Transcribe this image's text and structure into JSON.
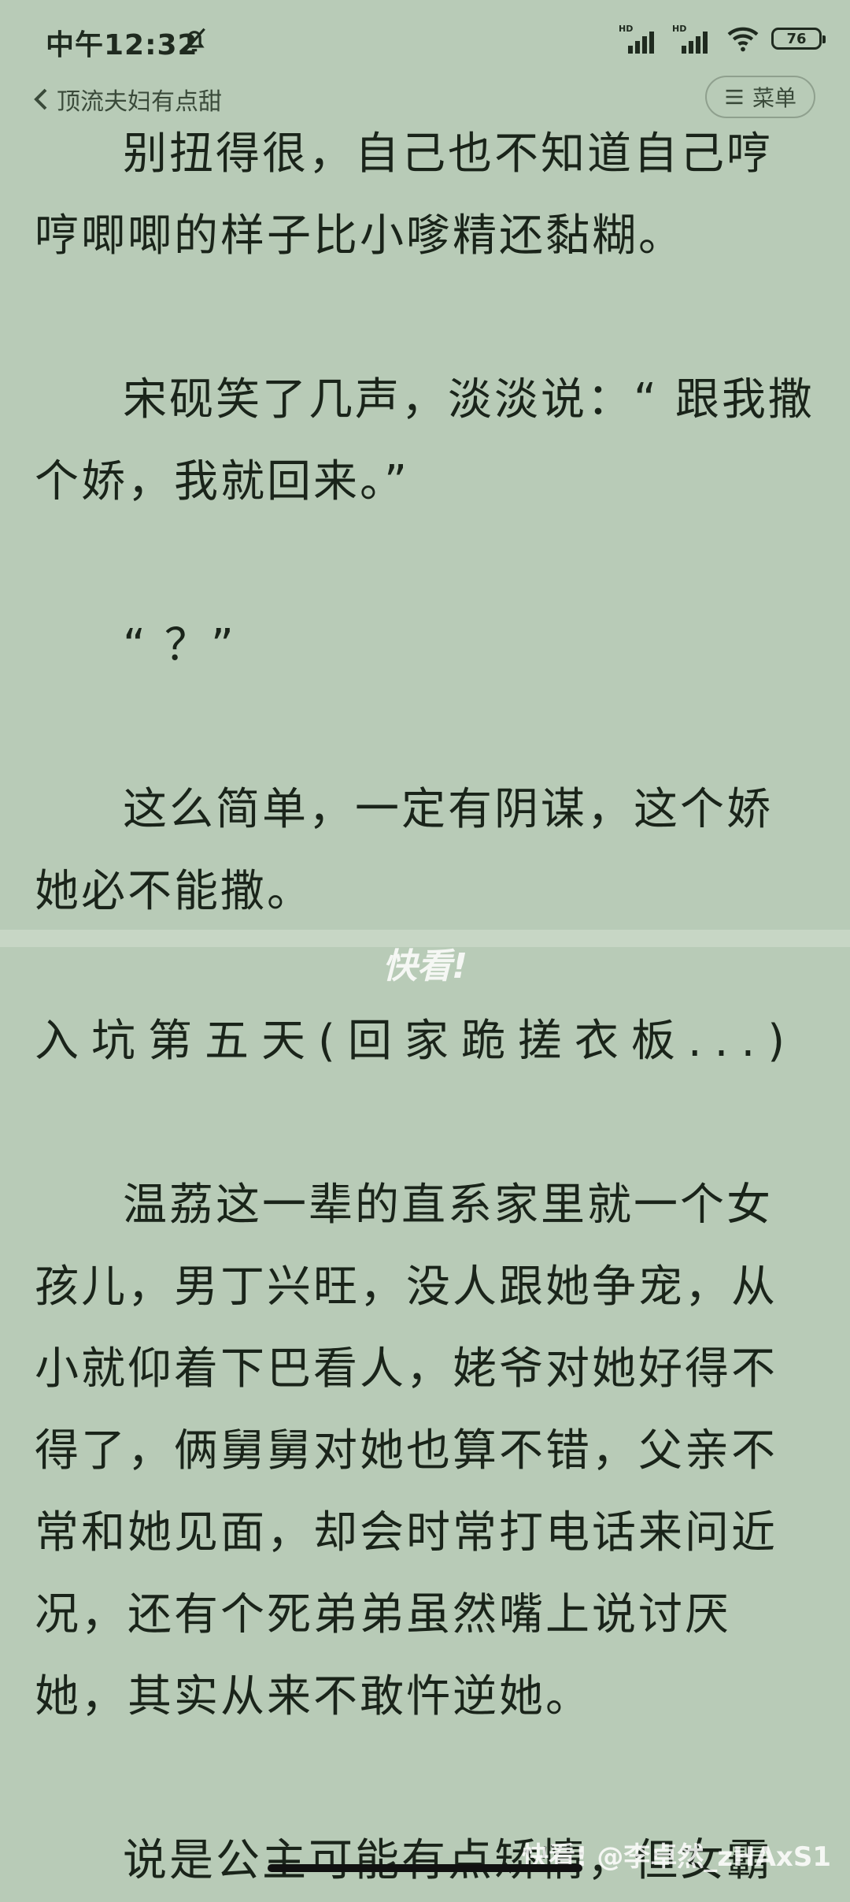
{
  "status_bar": {
    "time": "中午12:32",
    "network_labels": [
      "HD",
      "HD"
    ],
    "battery": "76"
  },
  "header": {
    "back_label": "顶流夫妇有点甜",
    "menu_label": "菜单",
    "menu_icon": "menu-lines-icon"
  },
  "content_top": {
    "paragraphs": [
      "别扭得很，自己也不知道自己哼哼唧唧的样子比小嗲精还黏糊。",
      "宋砚笑了几声，淡淡说：“ 跟我撒个娇，我就回来。”",
      "“ ？”",
      "这么简单，一定有阴谋，这个娇她必不能撒。"
    ]
  },
  "watermarks": {
    "center": "快看!",
    "bottom": "快看! @李卓然_zHAxS1"
  },
  "content_bottom": {
    "chapter_title": "入坑第五天(回家跪搓衣板...)",
    "paragraphs": [
      "温荔这一辈的直系家里就一个女孩儿，男丁兴旺，没人跟她争宠，从小就仰着下巴看人，姥爷对她好得不得了，俩舅舅对她也算不错，父亲不常和她见面，却会时常打电话来问近况，还有个死弟弟虽然嘴上说讨厌她，其实从来不敢忤逆她。",
      "说是公主可能有点矫情，但女霸"
    ]
  }
}
